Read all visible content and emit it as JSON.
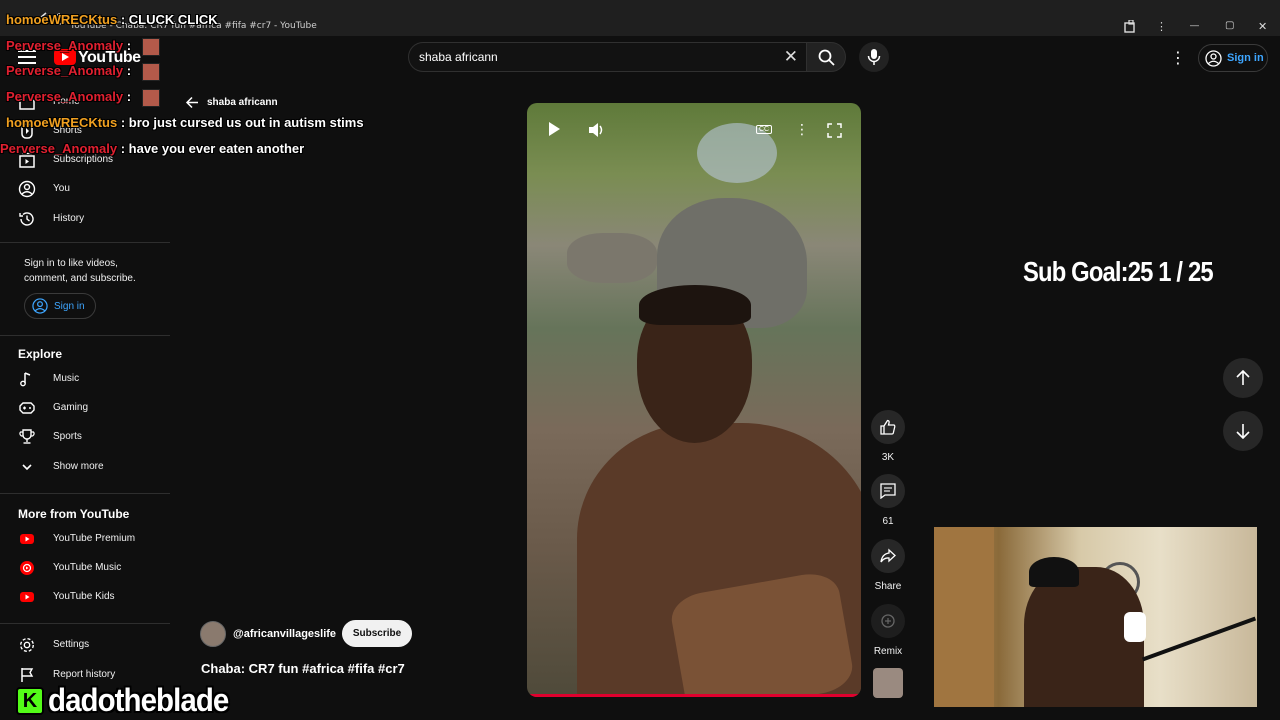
{
  "window": {
    "title": "YouTube - Chaba: CR7 fun #africa #fifa #cr7 - YouTube",
    "minimize": "—",
    "restore": "▢",
    "close": "✕"
  },
  "topbar": {
    "logo_text": "YouTube",
    "search_value": "shaba africann",
    "clear_symbol": "✕",
    "more_symbol": "⋮",
    "signin_label": "Sign in"
  },
  "sidebar": {
    "items_top": [
      {
        "label": "Home",
        "icon": "home-icon"
      },
      {
        "label": "Shorts",
        "icon": "shorts-icon"
      },
      {
        "label": "Subscriptions",
        "icon": "subscriptions-icon"
      },
      {
        "label": "You",
        "icon": "you-icon"
      },
      {
        "label": "History",
        "icon": "history-icon"
      }
    ],
    "signin_note": "Sign in to like videos, comment, and subscribe.",
    "signin_label": "Sign in",
    "explore_heading": "Explore",
    "explore_items": [
      {
        "label": "Music",
        "icon": "music-icon"
      },
      {
        "label": "Gaming",
        "icon": "gaming-icon"
      },
      {
        "label": "Sports",
        "icon": "sports-icon"
      },
      {
        "label": "Show more",
        "icon": "chevron-down-icon"
      }
    ],
    "more_heading": "More from YouTube",
    "more_items": [
      {
        "label": "YouTube Premium",
        "icon": "youtube-premium-icon"
      },
      {
        "label": "YouTube Music",
        "icon": "youtube-music-icon"
      },
      {
        "label": "YouTube Kids",
        "icon": "youtube-kids-icon"
      }
    ],
    "bottom_items": [
      {
        "label": "Settings",
        "icon": "gear-icon"
      },
      {
        "label": "Report history",
        "icon": "flag-icon"
      }
    ]
  },
  "shorts": {
    "back_query": "shaba africann",
    "like_count": "3K",
    "comment_count": "61",
    "share_label": "Share",
    "remix_label": "Remix",
    "channel_name": "@africanvillageslife",
    "subscribe_label": "Subscribe",
    "video_title": "Chaba: CR7 fun #africa #fifa #cr7",
    "cc_label": "CC"
  },
  "overlay": {
    "chat": [
      {
        "user": "homoeWRECKtus",
        "message": ": CLUCK CLICK",
        "color": "#f0a020"
      },
      {
        "user": "Perverse_Anomaly",
        "message": ":",
        "color": "#e02030"
      },
      {
        "user": "Perverse_Anomaly",
        "message": ":",
        "color": "#e02030"
      },
      {
        "user": "Perverse_Anomaly",
        "message": ":",
        "color": "#e02030"
      },
      {
        "user": "homoeWRECKtus",
        "message": ": bro just cursed us out in autism stims",
        "color": "#f0a020"
      },
      {
        "user": "Perverse_Anomaly",
        "message": ": have you ever eaten another",
        "color": "#e02030"
      }
    ],
    "sub_goal": "Sub Goal:25  1 / 25",
    "streamer_name": "dadotheblade",
    "kick_letter": "K"
  },
  "colors": {
    "accent_blue": "#3ea6ff",
    "brand_red": "#ff0000",
    "kick_green": "#53fc18"
  }
}
